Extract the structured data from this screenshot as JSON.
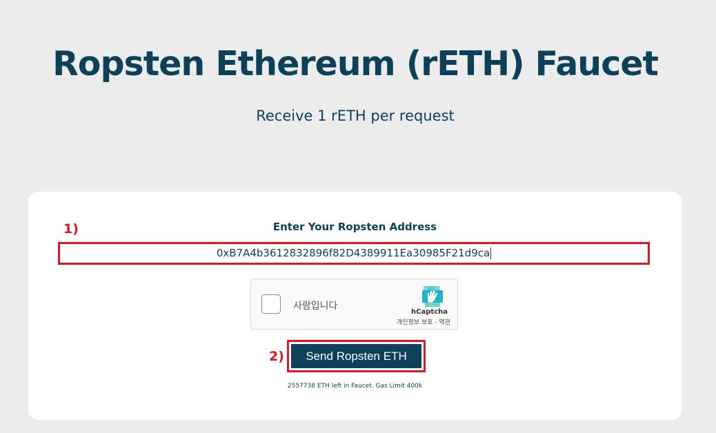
{
  "header": {
    "title": "Ropsten Ethereum (rETH) Faucet",
    "subtitle": "Receive 1 rETH per request"
  },
  "form": {
    "step1_marker": "1)",
    "step2_marker": "2)",
    "address_label": "Enter Your Ropsten Address",
    "address_value": "0xB7A4b3612832896f82D4389911Ea30985F21d9ca",
    "send_label": "Send Ropsten ETH",
    "status_text": "2557738 ETH left in Faucet. Gas Limit 400k"
  },
  "captcha": {
    "label": "사람입니다",
    "brand": "hCaptcha",
    "links": "개인정보 보호 - 약관",
    "checked": false
  },
  "colors": {
    "primary": "#0d4159",
    "background": "#ececec",
    "annotation_red": "#e3141f",
    "card": "#ffffff"
  },
  "icons": {
    "captcha_logo": "hcaptcha-hand-icon"
  }
}
